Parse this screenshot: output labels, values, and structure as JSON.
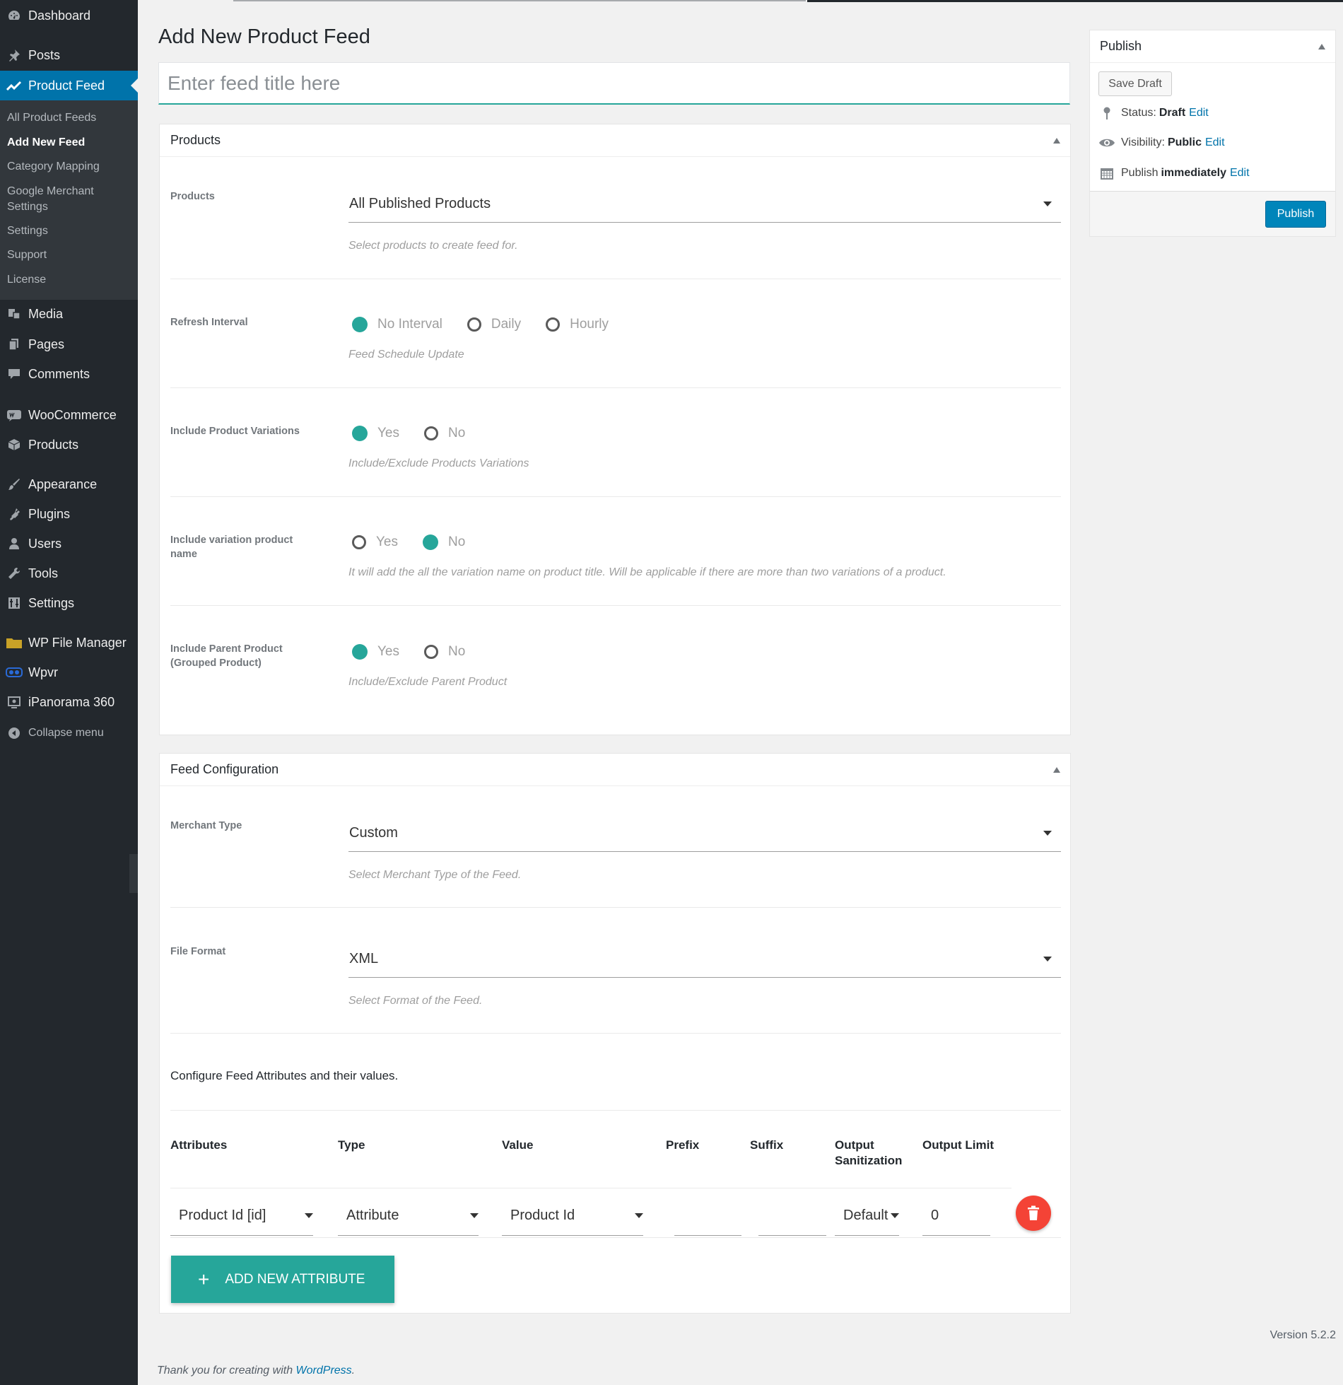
{
  "sidebar": {
    "items": [
      {
        "label": "Dashboard",
        "icon": "dashboard-icon"
      },
      {
        "label": "Posts",
        "icon": "pin-icon"
      },
      {
        "label": "Product Feed",
        "icon": "chart-line-icon"
      },
      {
        "label": "Media",
        "icon": "media-icon"
      },
      {
        "label": "Pages",
        "icon": "pages-icon"
      },
      {
        "label": "Comments",
        "icon": "comment-icon"
      },
      {
        "label": "WooCommerce",
        "icon": "woo-icon"
      },
      {
        "label": "Products",
        "icon": "box-icon"
      },
      {
        "label": "Appearance",
        "icon": "brush-icon"
      },
      {
        "label": "Plugins",
        "icon": "plug-icon"
      },
      {
        "label": "Users",
        "icon": "user-icon"
      },
      {
        "label": "Tools",
        "icon": "wrench-icon"
      },
      {
        "label": "Settings",
        "icon": "settings-icon"
      },
      {
        "label": "WP File Manager",
        "icon": "folder-icon"
      },
      {
        "label": "Wpvr",
        "icon": "vr-icon"
      },
      {
        "label": "iPanorama 360",
        "icon": "panorama-icon"
      },
      {
        "label": "Collapse menu",
        "icon": "collapse-icon"
      }
    ],
    "submenu": [
      "All Product Feeds",
      "Add New Feed",
      "Category Mapping",
      "Google Merchant Settings",
      "Settings",
      "Support",
      "License"
    ]
  },
  "page": {
    "title": "Add New Product Feed",
    "title_placeholder": "Enter feed title here"
  },
  "products_box": {
    "heading": "Products",
    "products_label": "Products",
    "products_value": "All Published Products",
    "products_help": "Select products to create feed for.",
    "refresh_label": "Refresh Interval",
    "refresh_options": [
      "No Interval",
      "Daily",
      "Hourly"
    ],
    "refresh_selected": "No Interval",
    "refresh_help": "Feed Schedule Update",
    "variations_label": "Include Product Variations",
    "variations_options": [
      "Yes",
      "No"
    ],
    "variations_selected": "Yes",
    "variations_help": "Include/Exclude Products Variations",
    "varname_label": "Include variation product name",
    "varname_options": [
      "Yes",
      "No"
    ],
    "varname_selected": "No",
    "varname_help": "It will add the all the variation name on product title. Will be applicable if there are more than two variations of a product.",
    "parent_label": "Include Parent Product (Grouped Product)",
    "parent_options": [
      "Yes",
      "No"
    ],
    "parent_selected": "Yes",
    "parent_help": "Include/Exclude Parent Product"
  },
  "feed_config": {
    "heading": "Feed Configuration",
    "merchant_label": "Merchant Type",
    "merchant_value": "Custom",
    "merchant_help": "Select Merchant Type of the Feed.",
    "format_label": "File Format",
    "format_value": "XML",
    "format_help": "Select Format of the Feed.",
    "attr_intro": "Configure Feed Attributes and their values.",
    "columns": [
      "Attributes",
      "Type",
      "Value",
      "Prefix",
      "Suffix",
      "Output Sanitization",
      "Output Limit"
    ],
    "row": {
      "attribute": "Product Id [id]",
      "type": "Attribute",
      "value": "Product Id",
      "prefix": "",
      "suffix": "",
      "sanitization": "Default",
      "limit": "0"
    },
    "add_button": "ADD NEW ATTRIBUTE"
  },
  "publish": {
    "heading": "Publish",
    "save_draft": "Save Draft",
    "status_label": "Status:",
    "status_value": "Draft",
    "visibility_label": "Visibility:",
    "visibility_value": "Public",
    "publish_label": "Publish",
    "publish_value": "immediately",
    "edit": "Edit",
    "publish_button": "Publish"
  },
  "footer": {
    "thanks_prefix": "Thank you for creating with",
    "wp_link": "WordPress",
    "thanks_suffix": ".",
    "version": "Version 5.2.2"
  },
  "colors": {
    "accent": "#26a69a",
    "wp_blue": "#0073aa",
    "danger": "#f44336",
    "sidebar": "#23282d"
  }
}
